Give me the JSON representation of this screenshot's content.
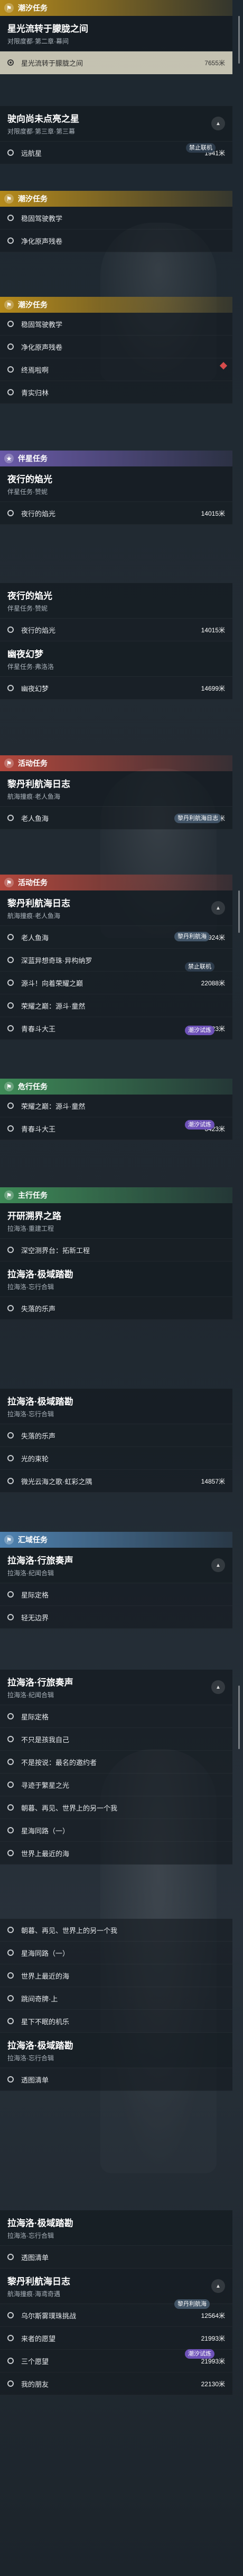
{
  "cat": {
    "explore": "潮汐任务",
    "side": "伴星任务",
    "event": "活动任务",
    "danger": "危行任务",
    "main": "主行任务",
    "tide": "潮汐任务",
    "region": "汇域任务",
    "explore_icon": "flag-icon",
    "side_icon": "star-icon"
  },
  "p1": {
    "title": "星光流转于朦胧之间",
    "sub": "对限度都·第二章·幕间",
    "item1": "星光流转于朦胧之间",
    "item1_dist": "7655米"
  },
  "p2": {
    "title": "驶向尚未点亮之星",
    "sub": "对限度都·第三章·第三幕",
    "item1": "远航星",
    "item1_dist": "1941米",
    "badge": "禁止联机"
  },
  "p3": {
    "items": [
      "稳固驾驶教学",
      "净化原声残卷"
    ]
  },
  "p4": {
    "items": [
      "稳固驾驶教学",
      "净化原声残卷",
      "终焉啦啊",
      "青实归林"
    ]
  },
  "p5": {
    "title": "夜行的焰光",
    "sub": "伴星任务·赞妮",
    "item1": "夜行的焰光",
    "item1_dist": "14015米"
  },
  "p6": {
    "title": "夜行的焰光",
    "sub": "伴星任务·赞妮",
    "item1": "夜行的焰光",
    "item1_dist": "14015米",
    "title2": "幽夜幻梦",
    "sub2": "伴星任务·弗洛洛",
    "item2": "幽夜幻梦",
    "item2_dist": "14699米"
  },
  "p7": {
    "title": "黎丹利航海日志",
    "sub": "航海撞痕·老人鱼海",
    "badge": "黎丹利航海日志",
    "item1": "老人鱼海",
    "item1_dist": "11924米"
  },
  "p8": {
    "title": "黎丹利航海日志",
    "sub": "航海撞痕·老人鱼海",
    "badge": "黎丹利航海",
    "items": [
      {
        "label": "老人鱼海",
        "dist": "11924米"
      },
      {
        "label": "深蓝异想奇珠·异构纳罗",
        "dist": ""
      },
      {
        "label": "源斗！向着荣耀之巅",
        "dist": "22088米"
      },
      {
        "label": "荣耀之巅：源斗·童然",
        "dist": ""
      },
      {
        "label": "青春斗大王",
        "dist": "6423米"
      }
    ],
    "badge2": "禁止联机",
    "badge3": "潮汐试炼"
  },
  "p9": {
    "items": [
      {
        "label": "荣耀之巅：源斗·童然",
        "dist": ""
      },
      {
        "label": "青春斗大王",
        "dist": "6423米"
      }
    ],
    "badge": "潮汐试炼"
  },
  "p10": {
    "title": "开研溯界之路",
    "sub": "拉海洛·重建工程",
    "item1": "深空测界台：拓新工程",
    "title2": "拉海洛·极域踏勘",
    "sub2": "拉海洛·忘行合辑",
    "item2": "失落的乐声"
  },
  "p11": {
    "title": "拉海洛·极域踏勘",
    "sub": "拉海洛·忘行合辑",
    "items": [
      {
        "label": "失落的乐声",
        "dist": ""
      },
      {
        "label": "光的束轮",
        "dist": ""
      },
      {
        "label": "微光云海之歌·虹彩之隅",
        "dist": "14857米"
      }
    ]
  },
  "p12": {
    "title": "拉海洛·行旅奏声",
    "sub": "拉海洛·纪闻合辑",
    "items": [
      "星际定格",
      "轻无边界"
    ]
  },
  "p13": {
    "title": "拉海洛·行旅奏声",
    "sub": "拉海洛·纪闻合辑",
    "items": [
      "星际定格",
      "不只是孩我自己",
      "不是按说：最名的邀约者",
      "寻迹于繁星之光",
      "朝暮、再见、世界上的另一个我",
      "星海同路（一）",
      "世界上最近的海"
    ]
  },
  "p14": {
    "items": [
      "朝暮、再见、世界上的另一个我",
      "星海同路（一）",
      "世界上最近的海",
      "跳间奇牌·上",
      "星下不眠的机乐"
    ],
    "title": "拉海洛·极域踏勘",
    "sub": "拉海洛·忘行合辑",
    "item_last": "透图清单"
  },
  "p15": {
    "title": "拉海洛·极域踏勘",
    "sub": "拉海洛·忘行合辑",
    "item1": "透图清单",
    "title2": "黎丹利航海日志",
    "sub2": "航海撞痕·海鸢奇遇",
    "badge": "黎丹利航海",
    "item2": "乌尔斯雾璞珠挑战",
    "item2_dist": "12564米",
    "item3": "来者的愿望",
    "item3_dist": "21993米",
    "item4": "三个愿望",
    "item4_dist": "21993米",
    "item5": "我的朋友",
    "item5_dist": "22130米",
    "badge2": "潮汐试炼"
  }
}
